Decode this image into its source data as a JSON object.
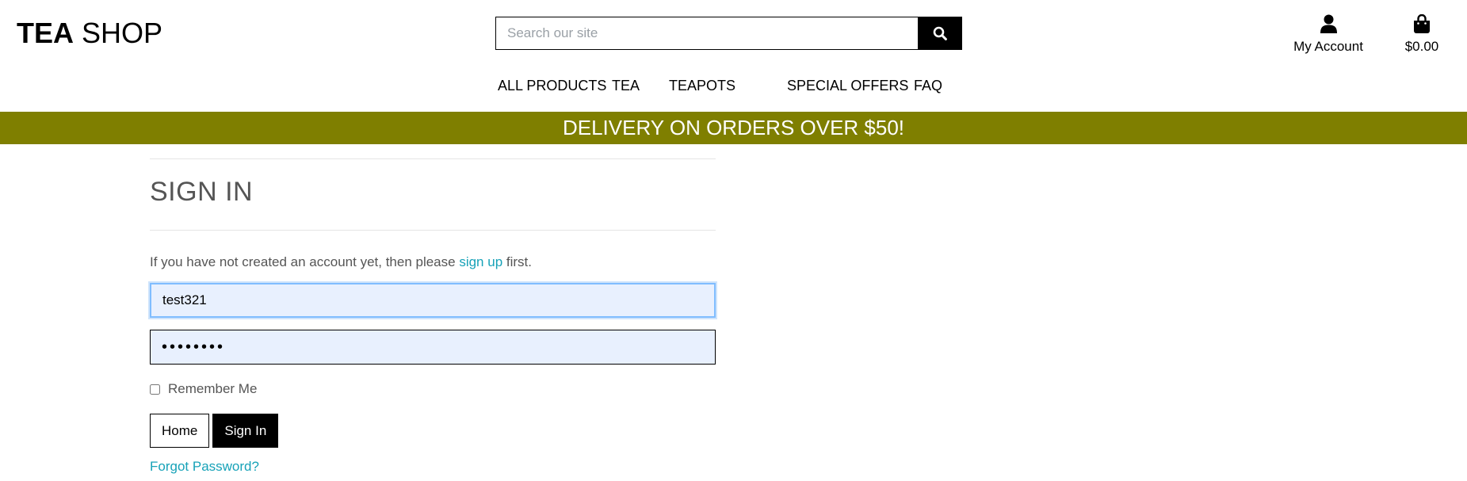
{
  "header": {
    "logo_bold": "TEA",
    "logo_light": "SHOP",
    "search": {
      "placeholder": "Search our site",
      "value": "",
      "icon": "search-icon"
    },
    "account": {
      "label": "My Account",
      "icon": "user-icon"
    },
    "bag": {
      "label": "$0.00",
      "icon": "shopping-bag-icon"
    }
  },
  "nav": {
    "items": [
      {
        "label": "ALL PRODUCTS"
      },
      {
        "label": "TEA"
      },
      {
        "label": "TEAPOTS"
      },
      {
        "label": "SPECIAL OFFERS"
      },
      {
        "label": "FAQ"
      }
    ]
  },
  "banner": {
    "text": "DELIVERY ON ORDERS OVER $50!",
    "color": "#7f7f00"
  },
  "signin": {
    "title": "SIGN IN",
    "intro_before": "If you have not created an account yet, then please ",
    "intro_link": "sign up",
    "intro_after": " first.",
    "username_value": "test321",
    "password_value": "••••••••",
    "remember_label": "Remember Me",
    "remember_checked": false,
    "home_button": "Home",
    "signin_button": "Sign In",
    "forgot_link": "Forgot Password?"
  },
  "colors": {
    "link": "#17a2b8",
    "banner": "#7f7f00"
  }
}
